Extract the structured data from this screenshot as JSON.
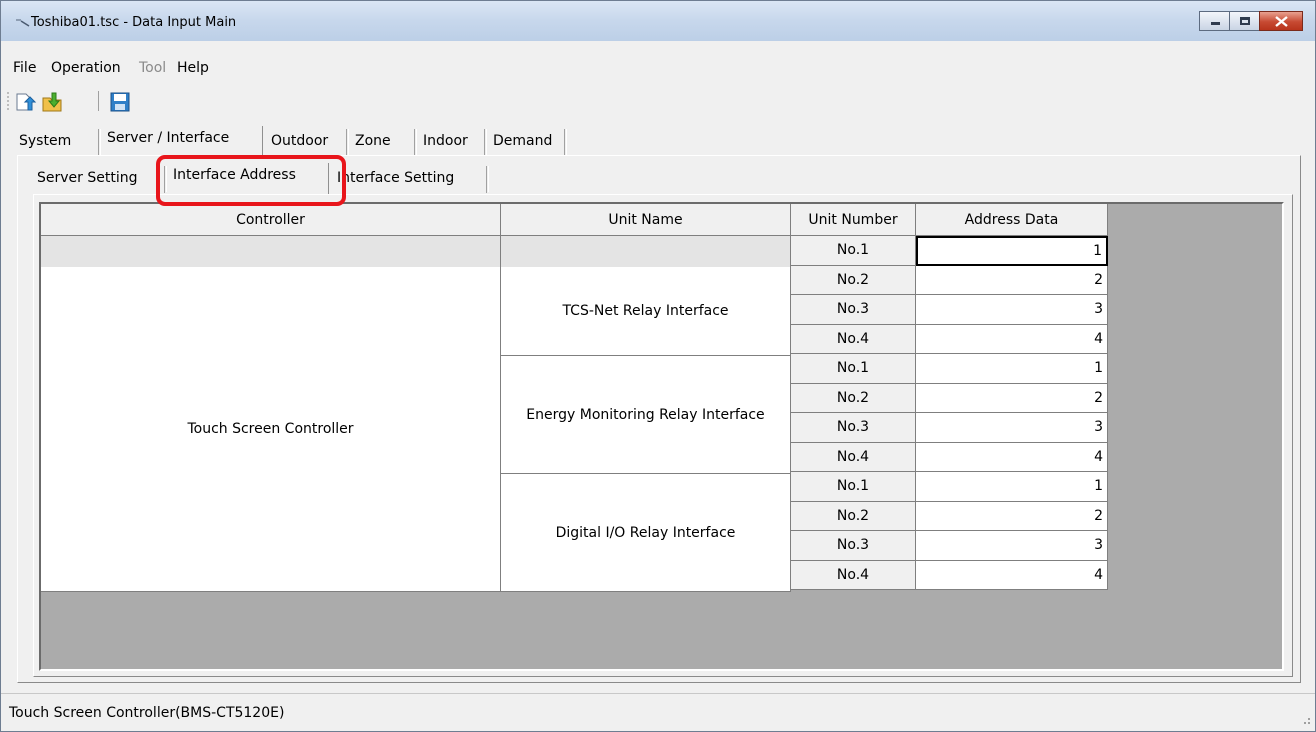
{
  "window": {
    "title": "Toshiba01.tsc - Data Input Main"
  },
  "menu": {
    "file": "File",
    "operation": "Operation",
    "tool": "Tool",
    "help": "Help"
  },
  "toolbar": {
    "icons": [
      "open-upload-icon",
      "import-download-icon",
      "save-icon"
    ]
  },
  "main_tabs": [
    "System",
    "Server / Interface",
    "Outdoor",
    "Zone",
    "Indoor",
    "Demand"
  ],
  "sub_tabs": [
    "Server Setting",
    "Interface Address",
    "Interface Setting"
  ],
  "grid": {
    "headers": {
      "controller": "Controller",
      "unit_name": "Unit Name",
      "unit_number": "Unit Number",
      "address_data": "Address Data"
    },
    "controller": "Touch Screen Controller",
    "groups": [
      {
        "unit_name": "TCS-Net Relay Interface",
        "rows": [
          {
            "unit_number": "No.1",
            "address": "1"
          },
          {
            "unit_number": "No.2",
            "address": "2"
          },
          {
            "unit_number": "No.3",
            "address": "3"
          },
          {
            "unit_number": "No.4",
            "address": "4"
          }
        ]
      },
      {
        "unit_name": "Energy Monitoring Relay Interface",
        "rows": [
          {
            "unit_number": "No.1",
            "address": "1"
          },
          {
            "unit_number": "No.2",
            "address": "2"
          },
          {
            "unit_number": "No.3",
            "address": "3"
          },
          {
            "unit_number": "No.4",
            "address": "4"
          }
        ]
      },
      {
        "unit_name": "Digital I/O Relay Interface",
        "rows": [
          {
            "unit_number": "No.1",
            "address": "1"
          },
          {
            "unit_number": "No.2",
            "address": "2"
          },
          {
            "unit_number": "No.3",
            "address": "3"
          },
          {
            "unit_number": "No.4",
            "address": "4"
          }
        ]
      }
    ]
  },
  "status": {
    "text": "Touch Screen Controller(BMS-CT5120E)"
  },
  "colors": {
    "highlight": "#e8151b",
    "grid_background": "#ababab"
  }
}
